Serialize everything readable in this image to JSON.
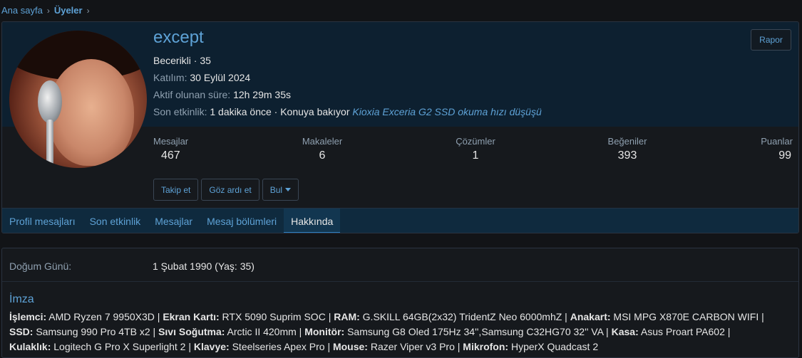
{
  "breadcrumb": {
    "home": "Ana sayfa",
    "current": "Üyeler"
  },
  "profile": {
    "username": "except",
    "rank_line": "Becerikli · 35",
    "joined_label": "Katılım:",
    "joined_value": "30 Eylül 2024",
    "online_label": "Aktif olunan süre:",
    "online_value": "12h 29m 35s",
    "last_label": "Son etkinlik:",
    "last_value": "1 dakika önce · Konuya bakıyor",
    "last_thread": "Kioxia Exceria G2 SSD okuma hızı düşüşü",
    "report": "Rapor"
  },
  "stats": [
    {
      "label": "Mesajlar",
      "value": "467"
    },
    {
      "label": "Makaleler",
      "value": "6"
    },
    {
      "label": "Çözümler",
      "value": "1"
    },
    {
      "label": "Beğeniler",
      "value": "393"
    },
    {
      "label": "Puanlar",
      "value": "99"
    }
  ],
  "actions": {
    "follow": "Takip et",
    "ignore": "Göz ardı et",
    "find": "Bul"
  },
  "tabs": [
    "Profil mesajları",
    "Son etkinlik",
    "Mesajlar",
    "Mesaj bölümleri",
    "Hakkında"
  ],
  "about": {
    "dob_label": "Doğum Günü:",
    "dob_value": "1 Şubat 1990 (Yaş: 35)",
    "sig_title": "İmza",
    "signature": [
      {
        "k": "İşlemci:",
        "v": " AMD Ryzen 7 9950X3D | "
      },
      {
        "k": "Ekran Kartı:",
        "v": " RTX 5090 Suprim SOC | "
      },
      {
        "k": "RAM:",
        "v": " G.SKILL 64GB(2x32) TridentZ Neo 6000mhZ | "
      },
      {
        "k": "Anakart:",
        "v": " MSI MPG X870E CARBON WIFI | "
      },
      {
        "k": "SSD:",
        "v": " Samsung 990 Pro 4TB x2 | "
      },
      {
        "k": "Sıvı Soğutma:",
        "v": " Arctic II 420mm | "
      },
      {
        "k": "Monitör:",
        "v": " Samsung G8 Oled 175Hz 34'',Samsung C32HG70 32'' VA | "
      },
      {
        "k": "Kasa:",
        "v": " Asus Proart PA602 | "
      },
      {
        "k": "Kulaklık:",
        "v": " Logitech G Pro X Superlight 2 | "
      },
      {
        "k": "Klavye:",
        "v": " Steelseries Apex Pro | "
      },
      {
        "k": "Mouse:",
        "v": " Razer Viper v3 Pro | "
      },
      {
        "k": "Mikrofon:",
        "v": " HyperX Quadcast 2"
      }
    ]
  }
}
